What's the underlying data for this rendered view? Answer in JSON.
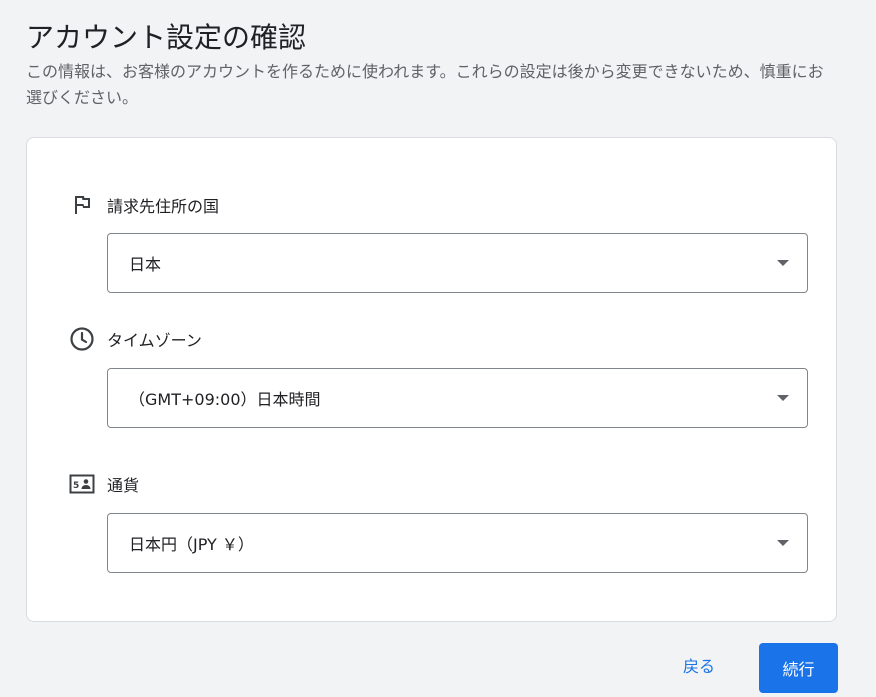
{
  "header": {
    "title": "アカウント設定の確認",
    "description": "この情報は、お客様のアカウントを作るために使われます。これらの設定は後から変更できないため、慎重にお選びください。"
  },
  "settings": {
    "country": {
      "label": "請求先住所の国",
      "icon": "flag-icon",
      "value": "日本"
    },
    "timezone": {
      "label": "タイムゾーン",
      "icon": "clock-icon",
      "value": "（GMT+09:00）日本時間"
    },
    "currency": {
      "label": "通貨",
      "icon": "currency-icon",
      "value": "日本円（JPY ￥）"
    }
  },
  "footer": {
    "back_label": "戻る",
    "continue_label": "続行"
  },
  "colors": {
    "background": "#f1f3f4",
    "card": "#ffffff",
    "accent": "#1a73e8",
    "border": "#80868b",
    "text": "#202124",
    "secondary_text": "#5f6368"
  }
}
